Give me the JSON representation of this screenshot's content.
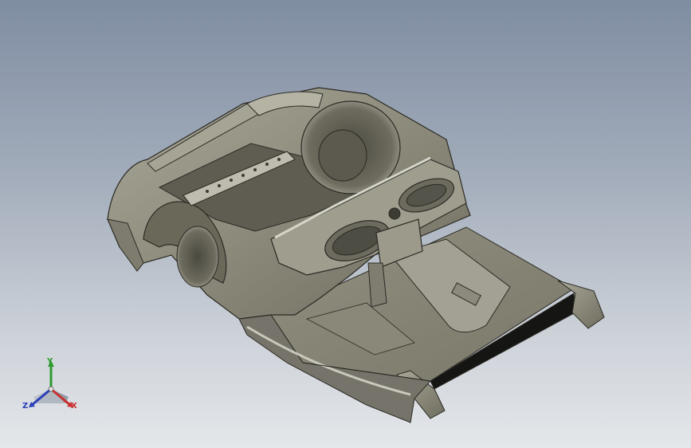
{
  "viewport": {
    "background_top": "#7f8da2",
    "background_bottom": "#e4e7ea"
  },
  "model": {
    "body_color": "#8d8b7c",
    "shadow_color": "#4f4d43",
    "highlight_color": "#c9c8bc",
    "edge_color": "#2b2a24"
  },
  "triad": {
    "x_label": "X",
    "y_label": "Y",
    "z_label": "Z",
    "x_color": "#c83030",
    "y_color": "#2f9a2f",
    "z_color": "#2a3fb8"
  }
}
